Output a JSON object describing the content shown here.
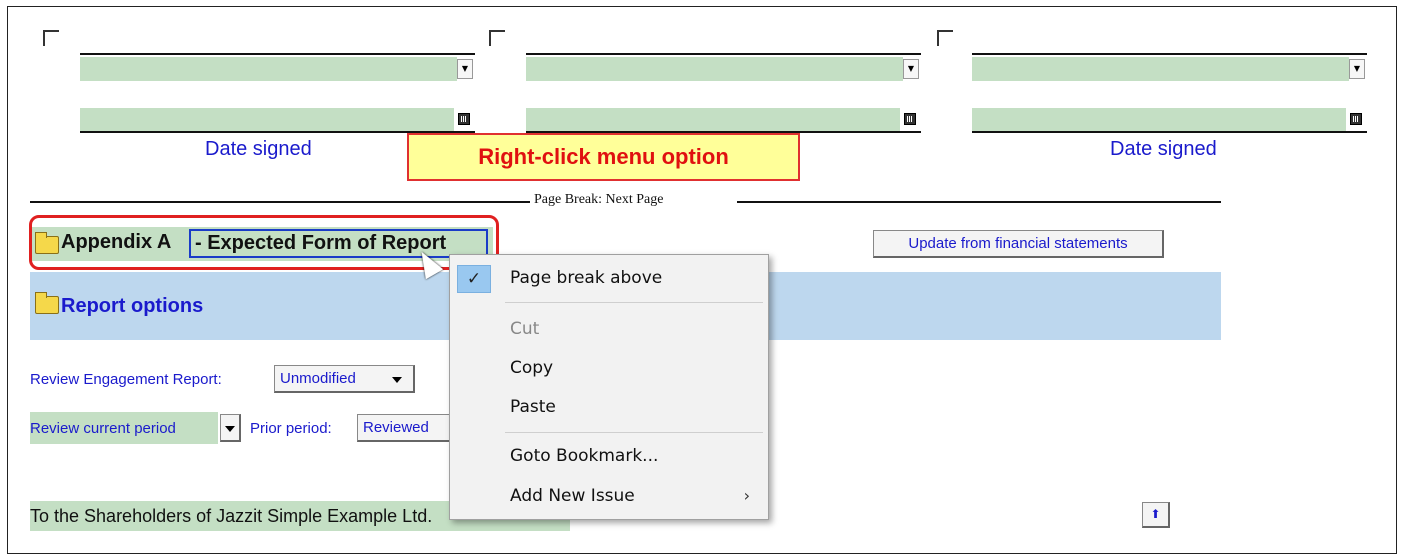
{
  "signatures": {
    "date_signed_left": "Date signed",
    "date_signed_right": "Date signed"
  },
  "callout": {
    "text": "Right-click menu option"
  },
  "page_break": {
    "label": "Page Break: Next Page"
  },
  "appendix": {
    "prefix": "Appendix A",
    "selected_text": " - Expected Form of Report",
    "update_button": "Update from financial statements"
  },
  "report_options": {
    "label": "Report options"
  },
  "review": {
    "engagement_label": "Review Engagement Report:",
    "engagement_value": "Unmodified",
    "current_period_value": "Review current period",
    "prior_label": "Prior period:",
    "prior_value": "Reviewed"
  },
  "addressee": {
    "text": "To the Shareholders of Jazzit Simple Example Ltd."
  },
  "context_menu": {
    "items": [
      {
        "label": "Page break above",
        "checked": true,
        "enabled": true
      },
      {
        "label": "Cut",
        "enabled": false
      },
      {
        "label": "Copy",
        "enabled": true
      },
      {
        "label": "Paste",
        "enabled": true
      },
      {
        "label": "Goto Bookmark...",
        "enabled": true
      },
      {
        "label": "Add New Issue",
        "enabled": true,
        "submenu_arrow": "›"
      }
    ],
    "check_glyph": "✓"
  },
  "colors": {
    "field_green": "#c4dfc4",
    "band_blue": "#bdd7ee",
    "link_blue": "#1a1acc",
    "callout_red": "#e01010",
    "callout_yellow": "#ffff99"
  }
}
